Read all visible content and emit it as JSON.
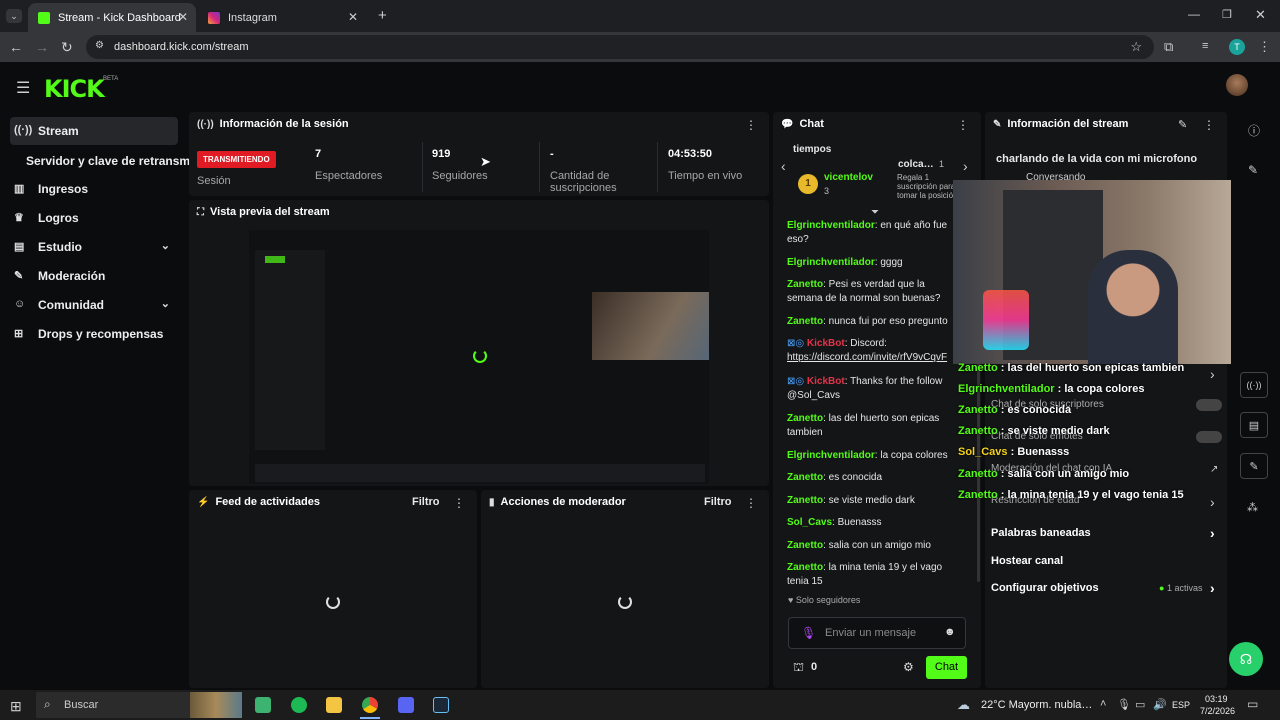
{
  "browser": {
    "tabs": [
      {
        "title": "Stream - Kick Dashboard"
      },
      {
        "title": "Instagram"
      }
    ],
    "url": "dashboard.kick.com/stream"
  },
  "brand": {
    "logo": "KICK",
    "beta": "BETA",
    "accent": "#53fc18"
  },
  "sidebar": {
    "items": [
      {
        "label": "Stream",
        "icon": "broadcast-icon"
      },
      {
        "label": "Servidor y clave de retransm"
      },
      {
        "label": "Ingresos",
        "icon": "bar-chart-icon"
      },
      {
        "label": "Logros",
        "icon": "trophy-icon"
      },
      {
        "label": "Estudio",
        "icon": "studio-icon"
      },
      {
        "label": "Moderación",
        "icon": "wrench-icon"
      },
      {
        "label": "Comunidad",
        "icon": "community-icon"
      },
      {
        "label": "Drops y recompensas",
        "icon": "drops-icon"
      }
    ]
  },
  "session": {
    "title": "Información de la sesión",
    "status": "TRANSMITIENDO",
    "status_label": "Sesión",
    "viewers": "7",
    "viewers_label": "Espectadores",
    "followers": "919",
    "followers_label": "Seguidores",
    "subs": "-",
    "subs_label": "Cantidad de suscripciones",
    "uptime": "04:53:50",
    "uptime_label": "Tiempo en vivo"
  },
  "preview": {
    "title": "Vista previa del stream"
  },
  "activity": {
    "title": "Feed de actividades",
    "filter": "Filtro"
  },
  "modactions": {
    "title": "Acciones de moderador",
    "filter": "Filtro"
  },
  "chat": {
    "title": "Chat",
    "pinned_top": "tiempos",
    "gifter": {
      "user": "vicentelov",
      "level": "1",
      "count": "3"
    },
    "gift": {
      "user": "colca…",
      "count": "1",
      "text": "Regala 1 suscripción para tomar la posición 3"
    },
    "messages": [
      {
        "user": "Elgrinchventilador",
        "text": "en qué año fue eso?"
      },
      {
        "user": "Elgrinchventilador",
        "text": "gggg"
      },
      {
        "user": "Zanetto",
        "text": "Pesi es verdad que la semana de la normal son buenas?"
      },
      {
        "user": "Zanetto",
        "text": "nunca fui por eso pregunto"
      },
      {
        "user": "KickBot",
        "text": "Discord:",
        "link": "https://discord.com/invite/rfV9vCqvF"
      },
      {
        "user": "KickBot",
        "text": "Thanks for the follow @Sol_Cavs"
      },
      {
        "user": "Zanetto",
        "text": "las del huerto son epicas tambien"
      },
      {
        "user": "Elgrinchventilador",
        "text": "la copa colores"
      },
      {
        "user": "Zanetto",
        "text": "es conocida"
      },
      {
        "user": "Zanetto",
        "text": "se viste medio dark"
      },
      {
        "user": "Sol_Cavs",
        "text": "Buenasss"
      },
      {
        "user": "Zanetto",
        "text": "salia con un amigo mio"
      },
      {
        "user": "Zanetto",
        "text": "la mina tenia 19 y el vago tenia 15"
      }
    ],
    "followers_only": "Solo seguidores",
    "placeholder": "Enviar un mensaje",
    "points": "0",
    "send": "Chat"
  },
  "stream_info": {
    "title": "Información del stream",
    "stream_title": "charlando de la vida con mi microfono",
    "category": "Conversando",
    "rows": [
      {
        "label": "Chat de solo suscriptores"
      },
      {
        "label": "Chat de solo emotes"
      },
      {
        "label": "Moderación del chat con IA"
      },
      {
        "label": "Restricción de edad"
      },
      {
        "label": "Palabras baneadas"
      },
      {
        "label": "Hostear canal"
      },
      {
        "label": "Configurar objetivos",
        "extra": "1 activas"
      }
    ]
  },
  "overlay_chat": [
    {
      "user": "Zanetto",
      "text": "las del huerto son epicas tambien"
    },
    {
      "user": "Elgrinchventilador",
      "text": "la copa colores"
    },
    {
      "user": "Zanetto",
      "text": "es conocida"
    },
    {
      "user": "Zanetto",
      "text": "se viste medio dark"
    },
    {
      "user": "Sol_Cavs",
      "text": "Buenasss"
    },
    {
      "user": "Zanetto",
      "text": "salia con un amigo mio"
    },
    {
      "user": "Zanetto",
      "text": "la mina tenia 19 y el vago tenia 15"
    }
  ],
  "taskbar": {
    "search": "Buscar",
    "weather": "22°C Mayorm. nubla…",
    "lang": "ESP",
    "time": "03:19",
    "date": "7/2/2026"
  }
}
